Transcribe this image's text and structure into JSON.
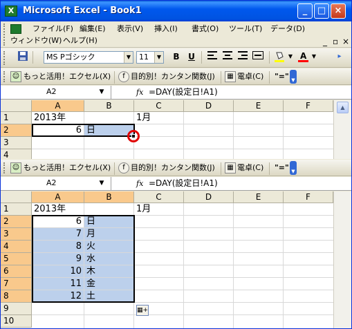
{
  "window": {
    "title": "Microsoft Excel - Book1",
    "app_icon": "excel-icon",
    "controls": [
      "_",
      "□",
      "×"
    ]
  },
  "menu": {
    "items": [
      "ファイル(F)",
      "編集(E)",
      "表示(V)",
      "挿入(I)",
      "書式(O)",
      "ツール(T)",
      "データ(D)",
      "ウィンドウ(W)",
      "ヘルプ(H)"
    ],
    "doc_controls": [
      "_",
      "▫",
      "×"
    ]
  },
  "format_toolbar": {
    "font": "MS Pゴシック",
    "size": "11",
    "bold": "B",
    "underline": "U",
    "fill_color": "#ffff00",
    "font_color": "#ff0000"
  },
  "addin_toolbar": {
    "excel_use": "もっと活用！エクセル(X)",
    "func_helper": "目的別！カンタン関数(J)",
    "calculator": "電卓(C)",
    "equals": "\"=\""
  },
  "formula_bar": {
    "name_box": "A2",
    "fx": "fx",
    "formula": "=DAY(設定日!A1)"
  },
  "columns": [
    "A",
    "B",
    "C",
    "D",
    "E",
    "F"
  ],
  "top_grid": {
    "rows": [
      "1",
      "2",
      "3",
      "4"
    ],
    "cells": {
      "a1": "2013年",
      "c1": "1月",
      "a2": "6",
      "b2": "日"
    }
  },
  "bottom_grid": {
    "rows": [
      "1",
      "2",
      "3",
      "4",
      "5",
      "6",
      "7",
      "8",
      "9",
      "10"
    ],
    "a1": "2013年",
    "c1": "1月",
    "data": [
      {
        "day": "6",
        "weekday": "日"
      },
      {
        "day": "7",
        "weekday": "月"
      },
      {
        "day": "8",
        "weekday": "火"
      },
      {
        "day": "9",
        "weekday": "水"
      },
      {
        "day": "10",
        "weekday": "木"
      },
      {
        "day": "11",
        "weekday": "金"
      },
      {
        "day": "12",
        "weekday": "土"
      }
    ]
  },
  "colors": {
    "selection_fill": "#bcd0ec",
    "selected_header": "#f9c98c",
    "highlight_circle": "#e00000",
    "titlebar": "#0058ee"
  }
}
